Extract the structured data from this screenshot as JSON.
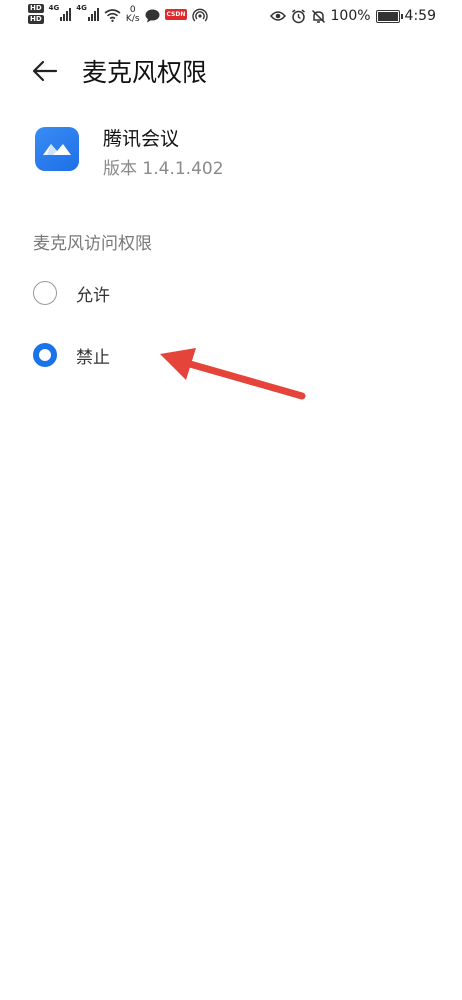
{
  "status_bar": {
    "network_1": "4G",
    "network_2": "4G",
    "speed_value": "0",
    "speed_unit": "K/s",
    "csdn_label": "CSDN",
    "battery_percent": "100%",
    "time": "4:59",
    "icons": [
      "hd-icon",
      "signal-icon",
      "wifi-icon",
      "chat-icon",
      "hotspot-icon",
      "eye-icon",
      "alarm-icon",
      "mute-icon",
      "battery-icon"
    ]
  },
  "header": {
    "title": "麦克风权限"
  },
  "app": {
    "name": "腾讯会议",
    "version": "版本 1.4.1.402",
    "icon_color": "#2b7ff0"
  },
  "permission": {
    "section_title": "麦克风访问权限",
    "options": [
      {
        "label": "允许",
        "selected": false
      },
      {
        "label": "禁止",
        "selected": true
      }
    ],
    "accent_color": "#1a73e8"
  },
  "annotation": {
    "arrow_color": "#e5443a"
  }
}
